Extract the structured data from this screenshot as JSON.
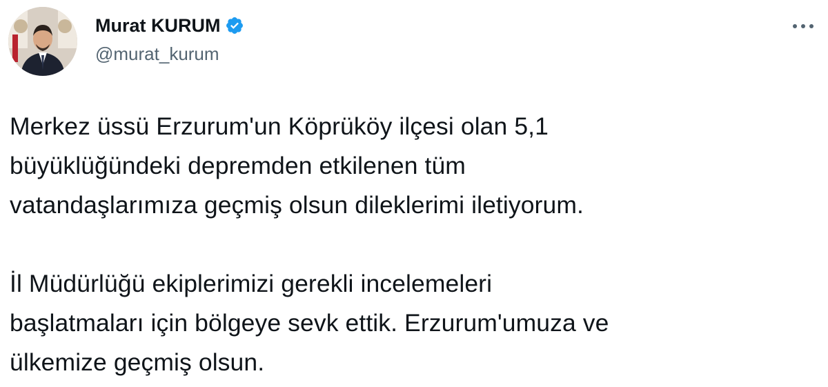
{
  "author": {
    "display_name": "Murat KURUM",
    "handle": "@murat_kurum",
    "verified": true,
    "verified_color": "#1d9bf0",
    "avatar_icon": "profile-photo"
  },
  "menu": {
    "icon": "more-horizontal-icon"
  },
  "tweet": {
    "paragraphs": [
      "Merkez üssü Erzurum'un Köprüköy ilçesi olan 5,1\nbüyüklüğündeki depremden etkilenen tüm\nvatandaşlarımıza geçmiş olsun dileklerimi iletiyorum.",
      "İl Müdürlüğü ekiplerimizi gerekli incelemeleri\nbaşlatmaları için bölgeye sevk ettik. Erzurum'umuza ve\nülkemize geçmiş olsun."
    ]
  }
}
